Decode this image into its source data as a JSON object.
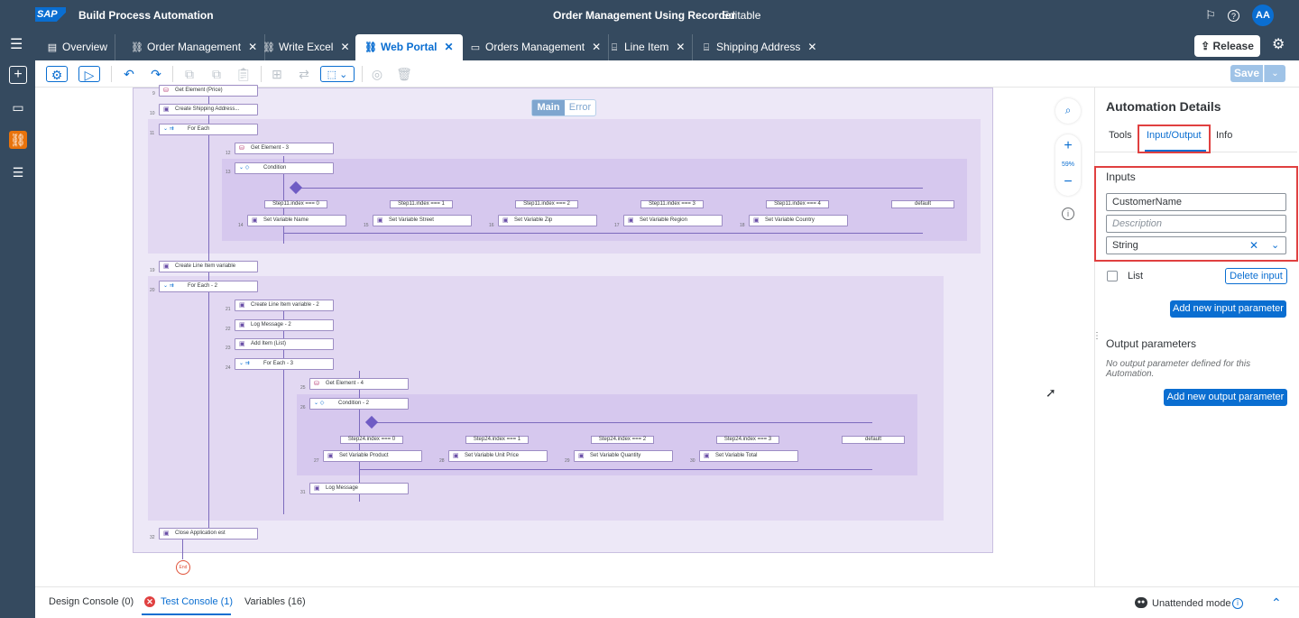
{
  "shell": {
    "logo": "SAP",
    "app_title": "Build Process Automation",
    "document_title": "Order Management Using Recorder",
    "document_state": "Editable",
    "avatar": "AA"
  },
  "tabs": [
    {
      "label": "Overview",
      "icon": "overview-icon",
      "closable": false
    },
    {
      "label": "Order Management",
      "icon": "process-icon",
      "closable": true
    },
    {
      "label": "Write Excel",
      "icon": "process-icon",
      "closable": true
    },
    {
      "label": "Web Portal",
      "icon": "process-icon",
      "closable": true,
      "active": true
    },
    {
      "label": "Orders Management",
      "icon": "application-icon",
      "closable": true
    },
    {
      "label": "Line Item",
      "icon": "data-type-icon",
      "closable": true
    },
    {
      "label": "Shipping Address",
      "icon": "data-type-icon",
      "closable": true
    }
  ],
  "header_actions": {
    "release": "Release"
  },
  "toolbar": {
    "save": "Save"
  },
  "canvas": {
    "segment_main": "Main",
    "segment_error": "Error",
    "zoom_level": "59%",
    "end_label": "End",
    "steps": {
      "s9": "Get Element (Price)",
      "s10": "Create Shipping Address...",
      "s11": "For Each",
      "s12": "Get Element - 3",
      "s13": "Condition",
      "s14": "Set Variable Name",
      "s15": "Set Variable Street",
      "s16": "Set Variable Zip",
      "s17": "Set Variable Region",
      "s18": "Set Variable Country",
      "s19": "Create Line Item variable",
      "s20": "For Each - 2",
      "s21": "Create Line Item variable - 2",
      "s22": "Log Message - 2",
      "s23": "Add Item (List)",
      "s24": "For Each - 3",
      "s25": "Get Element - 4",
      "s26": "Condition - 2",
      "s27": "Set Variable Product",
      "s28": "Set Variable Unit Price",
      "s29": "Set Variable Quantity",
      "s30": "Set Variable Total",
      "s31": "Log Message",
      "s32": "Close Application est"
    },
    "cases1": [
      "Step11.index === 0",
      "Step11.index === 1",
      "Step11.index === 2",
      "Step11.index === 3",
      "Step11.index === 4",
      "default"
    ],
    "cases2": [
      "Step24.index === 0",
      "Step24.index === 1",
      "Step24.index === 2",
      "Step24.index === 3",
      "default"
    ],
    "line_numbers": [
      "9",
      "10",
      "11",
      "12",
      "13",
      "14",
      "15",
      "16",
      "17",
      "18",
      "19",
      "20",
      "21",
      "22",
      "23",
      "24",
      "25",
      "26",
      "27",
      "28",
      "29",
      "30",
      "31",
      "32"
    ]
  },
  "panel": {
    "title": "Automation Details",
    "tabs": [
      "Tools",
      "Input/Output",
      "Info"
    ],
    "active_tab": "Input/Output",
    "inputs_title": "Inputs",
    "input_name": "CustomerName",
    "description_placeholder": "Description",
    "type_value": "String",
    "list_label": "List",
    "delete_input": "Delete input",
    "add_input": "Add new input parameter",
    "outputs_title": "Output parameters",
    "no_output_note": "No output parameter defined for this Automation.",
    "add_output": "Add new output parameter"
  },
  "bottom": {
    "design_console": "Design Console (0)",
    "test_console": "Test Console (1)",
    "variables": "Variables (16)",
    "unattended": "Unattended mode"
  },
  "colors": {
    "shell": "#354a5f",
    "accent": "#0a6ed1",
    "highlight_box": "#e04040",
    "flow_bg": "#ede8f7"
  }
}
